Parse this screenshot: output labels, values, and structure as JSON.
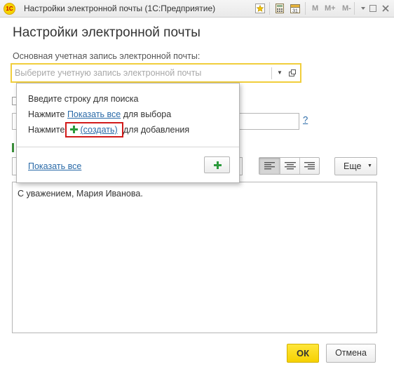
{
  "window": {
    "title": "Настройки электронной почты  (1С:Предприятие)",
    "logo_text": "1С",
    "memory_buttons": [
      "M",
      "M+",
      "M-"
    ],
    "icons": [
      "favorite-icon",
      "calculator-icon",
      "calendar-icon",
      "menu-icon",
      "minimize-icon",
      "maximize-icon",
      "close-icon"
    ],
    "calendar_day": "31"
  },
  "form": {
    "title": "Настройки электронной почты",
    "account_label": "Основная учетная запись электронной почты:",
    "account_value": "",
    "account_placeholder": "Выберите учетную запись электронной почты"
  },
  "popup": {
    "line1": "Введите строку для поиска",
    "line2_prefix": "Нажмите ",
    "line2_link": "Показать все",
    "line2_suffix": " для выбора",
    "line3_prefix": "Нажмите ",
    "line3_link": "(создать)",
    "line3_suffix": " для добавления",
    "show_all_link": "Показать все"
  },
  "partial": {
    "help_mark": "?"
  },
  "toolbar": {
    "more_label": "Еще",
    "align_active": "left"
  },
  "editor": {
    "text": "С уважением, Мария Иванова."
  },
  "footer": {
    "ok_label": "ОК",
    "cancel_label": "Отмена"
  },
  "colors": {
    "focus_border": "#f1ce3c",
    "link": "#2a6aa8",
    "add_green": "#2c9a3c",
    "highlight_red": "#d21b1b",
    "ok_button": "#f6d100"
  }
}
